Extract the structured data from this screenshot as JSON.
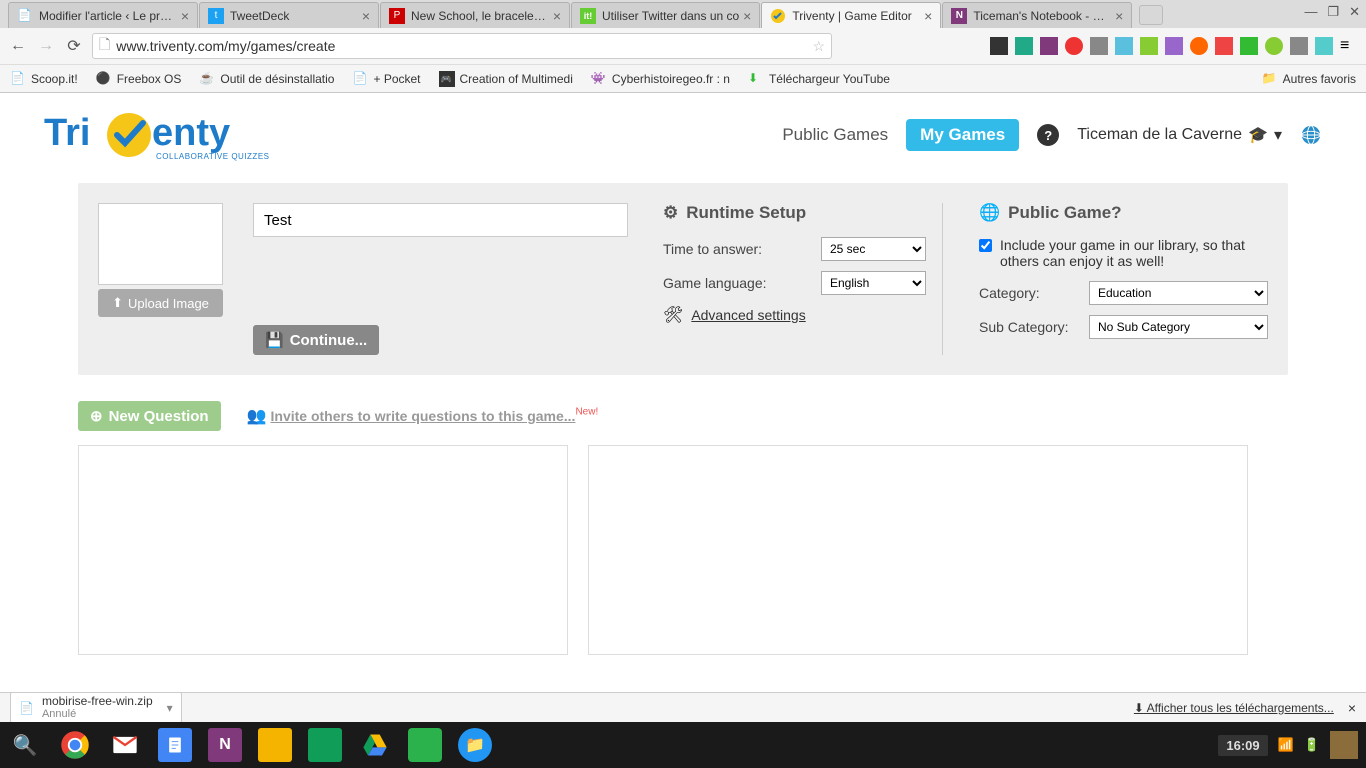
{
  "browser": {
    "tabs": [
      {
        "title": "Modifier l'article ‹ Le propu"
      },
      {
        "title": "TweetDeck"
      },
      {
        "title": "New School, le bracelet éle"
      },
      {
        "title": "Utiliser Twitter dans un co"
      },
      {
        "title": "Triventy | Game Editor"
      },
      {
        "title": "Ticeman's Notebook - Mic"
      }
    ],
    "url": "www.triventy.com/my/games/create",
    "bookmarks": [
      {
        "label": "Scoop.it!"
      },
      {
        "label": "Freebox OS"
      },
      {
        "label": "Outil de désinstallatio"
      },
      {
        "label": "+ Pocket"
      },
      {
        "label": "Creation of Multimedi"
      },
      {
        "label": "Cyberhistoiregeo.fr : n"
      },
      {
        "label": "Téléchargeur YouTube"
      }
    ],
    "other_bookmarks": "Autres favoris"
  },
  "nav": {
    "public_games": "Public Games",
    "my_games": "My Games",
    "user": "Ticeman de la Caverne"
  },
  "logo": {
    "brand": "Triventy",
    "tagline": "COLLABORATIVE QUIZZES"
  },
  "editor": {
    "upload_label": "Upload Image",
    "title_value": "Test",
    "continue_label": "Continue...",
    "runtime_title": "Runtime Setup",
    "time_label": "Time to answer:",
    "time_value": "25 sec",
    "lang_label": "Game language:",
    "lang_value": "English",
    "advanced": "Advanced settings",
    "public_title": "Public Game?",
    "include_text": "Include your game in our library, so that others can enjoy it as well!",
    "category_label": "Category:",
    "category_value": "Education",
    "subcat_label": "Sub Category:",
    "subcat_value": "No Sub Category"
  },
  "questions": {
    "new_btn": "New Question",
    "invite": "Invite others to write questions to this game...",
    "new_badge": "New!"
  },
  "download": {
    "file": "mobirise-free-win.zip",
    "status": "Annulé",
    "show_all": "Afficher tous les téléchargements..."
  },
  "taskbar": {
    "time": "16:09"
  }
}
